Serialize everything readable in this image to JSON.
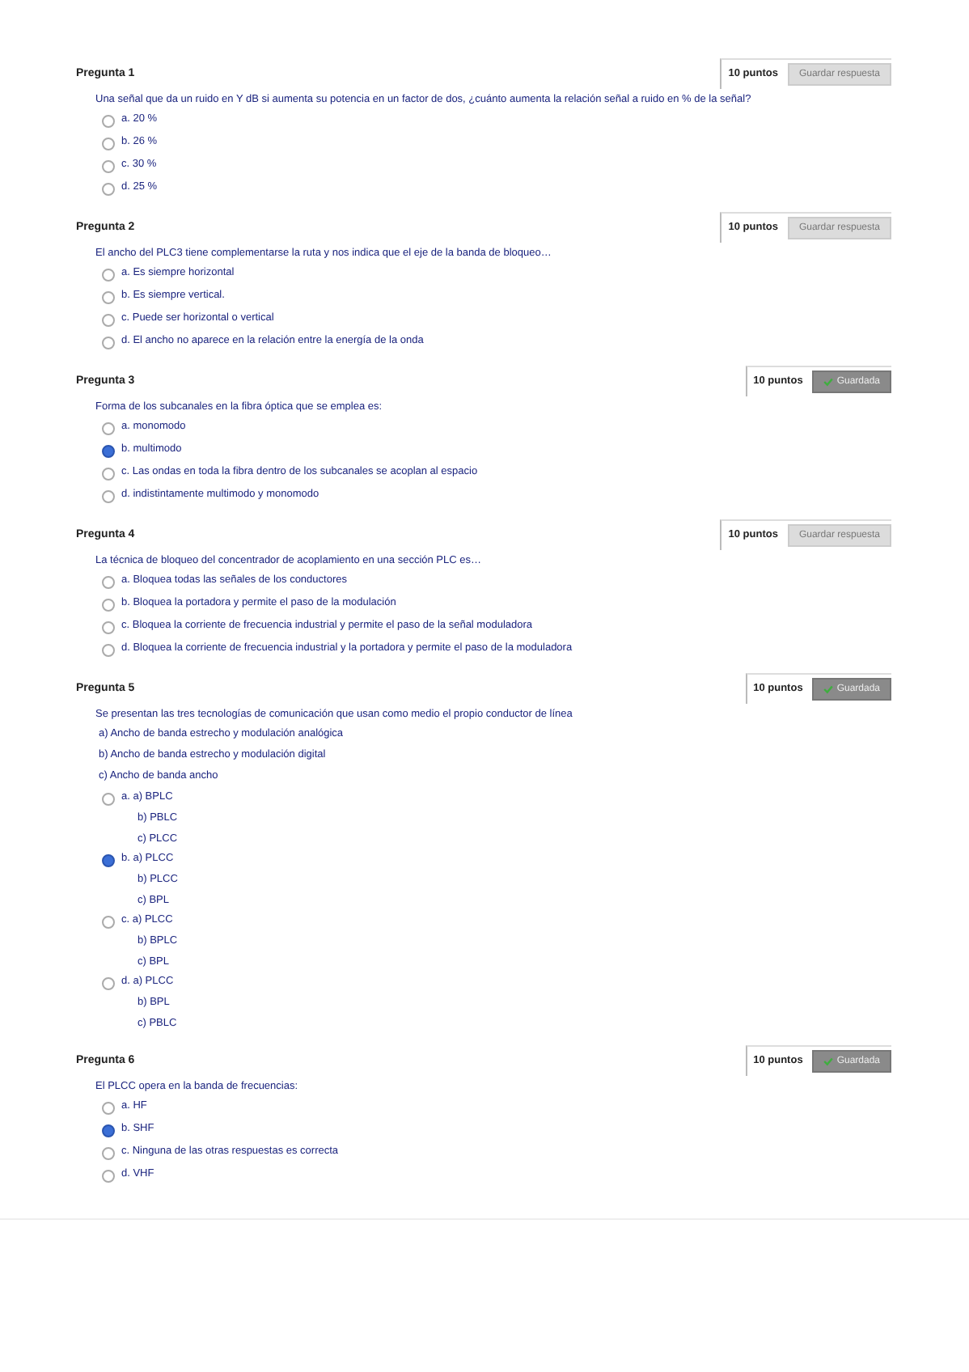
{
  "questions": [
    {
      "title": "Pregunta 1",
      "points": "10 puntos",
      "button": "Guardar respuesta",
      "saved": false,
      "statement": "Una señal que da un ruido en Y dB si aumenta su potencia en un factor de dos, ¿cuánto aumenta la relación señal a ruido en % de la señal?",
      "options": [
        {
          "label": "a. 20 %",
          "selected": false
        },
        {
          "label": "b. 26 %",
          "selected": false
        },
        {
          "label": "c. 30 %",
          "selected": false
        },
        {
          "label": "d. 25 %",
          "selected": false
        }
      ]
    },
    {
      "title": "Pregunta 2",
      "points": "10 puntos",
      "button": "Guardar respuesta",
      "saved": false,
      "statement": "El ancho del PLC3 tiene complementarse la ruta y nos indica que el eje de la banda de bloqueo…",
      "options": [
        {
          "label": "a. Es siempre horizontal",
          "selected": false
        },
        {
          "label": "b. Es siempre vertical.",
          "selected": false
        },
        {
          "label": "c. Puede ser horizontal o vertical",
          "selected": false
        },
        {
          "label": "d. El ancho no aparece en la relación entre la energía de la onda",
          "selected": false
        }
      ]
    },
    {
      "title": "Pregunta 3",
      "points": "10 puntos",
      "button": "Guardada",
      "saved": true,
      "statement": "Forma de los subcanales en la fibra óptica que se emplea es:",
      "options": [
        {
          "label": "a. monomodo",
          "selected": false
        },
        {
          "label": "b. multimodo",
          "selected": true
        },
        {
          "label": "c. Las ondas en toda la fibra dentro de los subcanales se acoplan al espacio",
          "selected": false
        },
        {
          "label": "d. indistintamente multimodo y monomodo",
          "selected": false
        }
      ]
    },
    {
      "title": "Pregunta 4",
      "points": "10 puntos",
      "button": "Guardar respuesta",
      "saved": false,
      "statement": "La técnica de bloqueo del concentrador de acoplamiento en una sección PLC es…",
      "options": [
        {
          "label": "a. Bloquea todas las señales de los conductores",
          "selected": false
        },
        {
          "label": "b. Bloquea la portadora y permite el paso de la modulación",
          "selected": false
        },
        {
          "label": "c. Bloquea la corriente de frecuencia industrial y permite el paso de la señal moduladora",
          "selected": false
        },
        {
          "label": "d. Bloquea la corriente de frecuencia industrial y la portadora y permite el paso de la moduladora",
          "selected": false
        }
      ]
    },
    {
      "title": "Pregunta 5",
      "points": "10 puntos",
      "button": "Guardada",
      "saved": true,
      "statement": "Se presentan las tres tecnologías de comunicación que usan como medio el propio conductor de línea",
      "notes": [
        "a) Ancho de banda estrecho y modulación analógica",
        "b) Ancho de banda estrecho y modulación digital",
        "c) Ancho de banda ancho"
      ],
      "options": [
        {
          "lines": [
            "a. a) BPLC",
            "b) PBLC",
            "c) PLCC"
          ],
          "selected": false
        },
        {
          "lines": [
            "b. a) PLCC",
            "b) PLCC",
            "c) BPL"
          ],
          "selected": true
        },
        {
          "lines": [
            "c. a) PLCC",
            "b) BPLC",
            "c) BPL"
          ],
          "selected": false
        },
        {
          "lines": [
            "d. a) PLCC",
            "b) BPL",
            "c) PBLC"
          ],
          "selected": false
        }
      ]
    },
    {
      "title": "Pregunta 6",
      "points": "10 puntos",
      "button": "Guardada",
      "saved": true,
      "statement": "El PLCC opera en la banda de frecuencias:",
      "options": [
        {
          "label": "a. HF",
          "selected": false
        },
        {
          "label": "b. SHF",
          "selected": true
        },
        {
          "label": "c. Ninguna de las otras respuestas es correcta",
          "selected": false
        },
        {
          "label": "d. VHF",
          "selected": false
        }
      ]
    }
  ]
}
